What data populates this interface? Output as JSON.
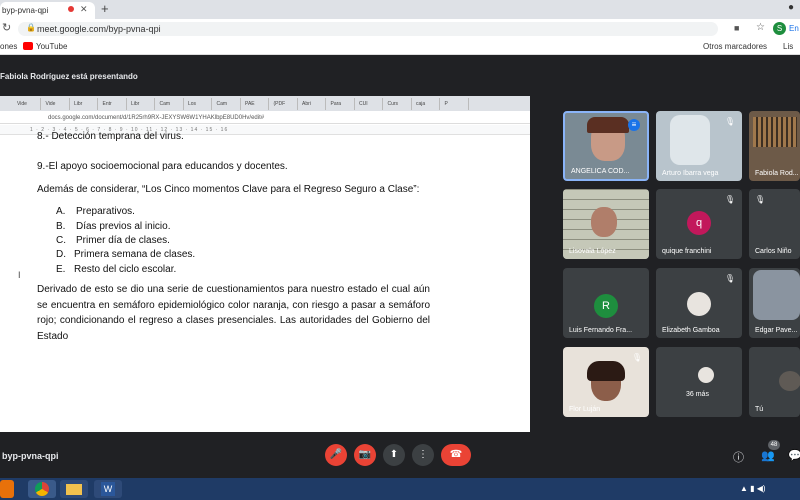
{
  "browser": {
    "tab_title": "byp-pvna-qpi",
    "tab_close": "✕",
    "new_tab": "+",
    "window_controls": "●",
    "url": "meet.google.com/byp-pvna-qpi",
    "profile_initial": "S",
    "profile_label": "En",
    "bookmarks": {
      "apps": "ones",
      "youtube": "YouTube",
      "other": "Otros marcadores",
      "list": "Lis"
    }
  },
  "meet": {
    "presenting_text": "Fabiola Rodríguez está presentando",
    "meeting_code": "byp-pvna-qpi",
    "participant_count": "48",
    "more_count_label": "36 más",
    "controls": {
      "mic": "🎤",
      "camera": "📷",
      "present": "⬆",
      "more": "⋮",
      "hangup": "☎",
      "info": "ⓘ",
      "people": "👥",
      "chat": "💬"
    }
  },
  "shared_screen": {
    "inner_tabs": [
      "Vide",
      "Vide",
      "Libr",
      "Entr",
      "Libr",
      "Cam",
      "Los",
      "Cam",
      "PAE",
      "(PDF",
      "Abri",
      "Para",
      "CUI",
      "Curs",
      "caja",
      "P"
    ],
    "inner_url": "docs.google.com/document/d/1R25rh9RX-JEXYSW6W1YHAKlbpE8UD0Hv/edit#",
    "ruler": "1  ·  2  ·  3  ·  4  ·  5  ·  6  ·  7  ·  8  ·  9  ·  10  ·  11  ·  12  ·  13  ·  14  ·  15  ·  16",
    "cursor": "I",
    "document": {
      "line_cut": "8.- Detección temprana del virus.",
      "line_9": "9.-El apoyo socioemocional para educandos y docentes.",
      "intro": "Además de considerar, “Los Cinco momentos Clave para el Regreso Seguro a Clase”:",
      "list": [
        {
          "marker": "A.",
          "text": "Preparativos."
        },
        {
          "marker": "B.",
          "text": "Días previos al inicio."
        },
        {
          "marker": "C.",
          "text": "Primer día de clases."
        },
        {
          "marker": "D.",
          "text": "Primera semana de clases."
        },
        {
          "marker": "E.",
          "text": "Resto del ciclo escolar."
        }
      ],
      "paragraph": "Derivado de esto se dio una serie de cuestionamientos para nuestro estado el cual aún se encuentra en semáforo epidemiológico color naranja, con riesgo a pasar a semáforo rojo; condicionando el regreso a clases presenciales. Las autoridades del Gobierno del Estado"
    }
  },
  "participants": [
    {
      "name": "ANGELICA COD...",
      "initial": ""
    },
    {
      "name": "Arturo Ibarra vega",
      "initial": ""
    },
    {
      "name": "Fabiola Rod...",
      "initial": ""
    },
    {
      "name": "Lisovala López",
      "initial": ""
    },
    {
      "name": "quique franchini",
      "initial": "q"
    },
    {
      "name": "Carlos Niño",
      "initial": ""
    },
    {
      "name": "Luis Fernando Fra...",
      "initial": "R"
    },
    {
      "name": "Elizabeth Gamboa",
      "initial": ""
    },
    {
      "name": "Edgar Pave...",
      "initial": ""
    },
    {
      "name": "Flor Luján",
      "initial": ""
    },
    {
      "name": "Tú",
      "initial": ""
    }
  ],
  "colors": {
    "meet_bg": "#202124",
    "tile_bg": "#3c4043",
    "active_speaker": "#8ab4f8",
    "hangup": "#ea4335",
    "avatar_q": "#c2185b",
    "avatar_r": "#1e8e3e"
  }
}
